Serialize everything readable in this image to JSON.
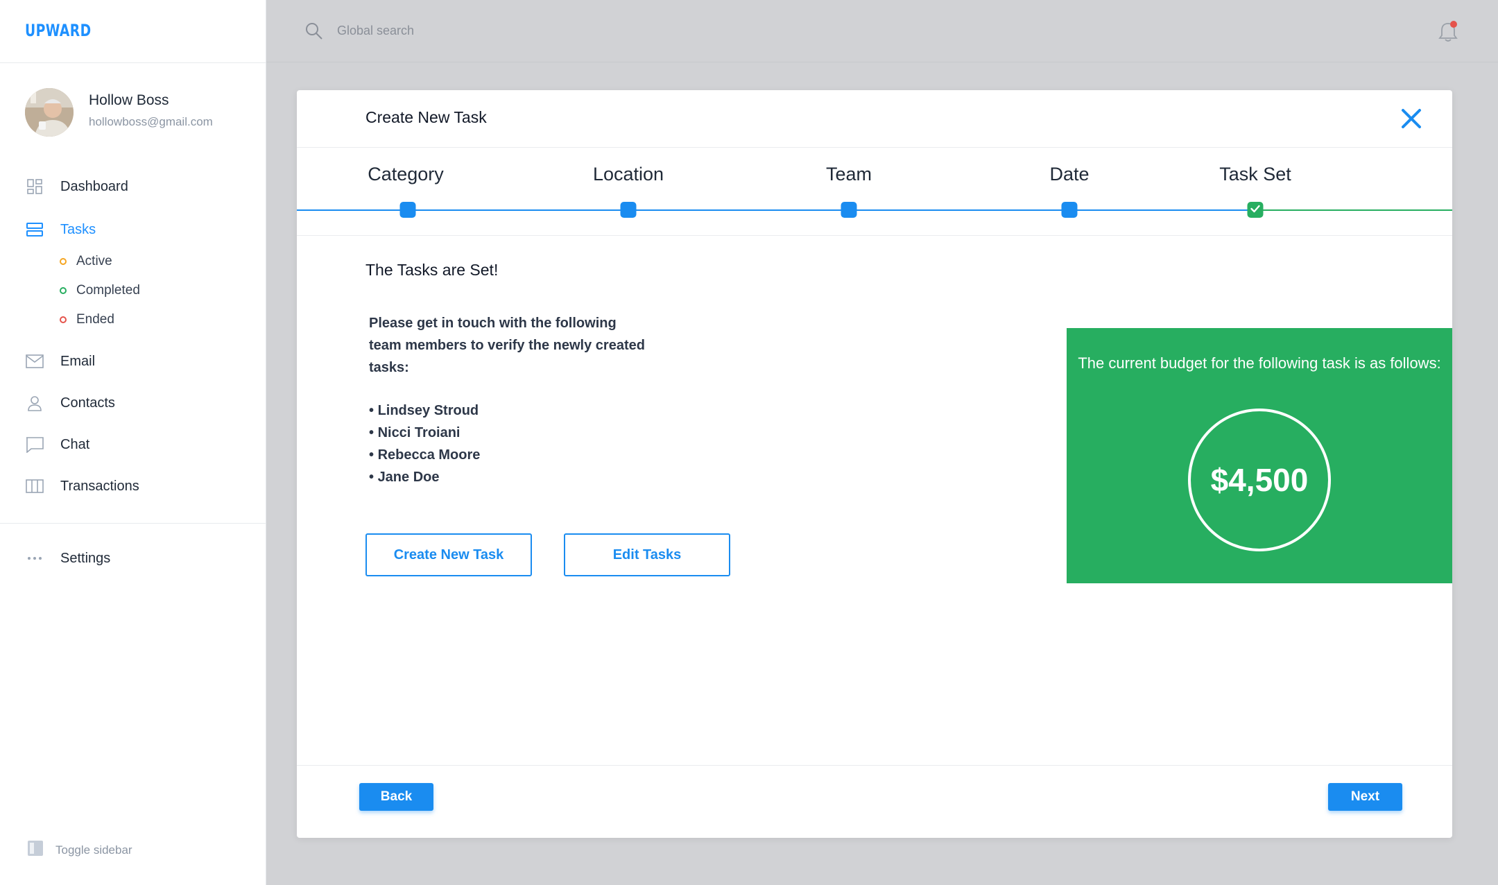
{
  "app": {
    "logo": "UPWARD"
  },
  "user": {
    "name": "Hollow Boss",
    "email": "hollowboss@gmail.com"
  },
  "sidebar": {
    "items": [
      {
        "label": "Dashboard",
        "icon": "dashboard-icon"
      },
      {
        "label": "Tasks",
        "icon": "tasks-icon",
        "active": true
      },
      {
        "label": "Email",
        "icon": "mail-icon"
      },
      {
        "label": "Contacts",
        "icon": "user-icon"
      },
      {
        "label": "Chat",
        "icon": "chat-icon"
      },
      {
        "label": "Transactions",
        "icon": "columns-icon"
      }
    ],
    "task_filters": [
      {
        "label": "Active",
        "color": "#f5a623"
      },
      {
        "label": "Completed",
        "color": "#27ae60"
      },
      {
        "label": "Ended",
        "color": "#e5534b"
      }
    ],
    "settings_label": "Settings",
    "toggle_label": "Toggle sidebar"
  },
  "search": {
    "placeholder": "Global search"
  },
  "modal": {
    "title": "Create New Task",
    "steps": [
      "Category",
      "Location",
      "Team",
      "Date",
      "Task Set"
    ],
    "set_title": "The Tasks are Set!",
    "message": "Please get in touch with the following team members to verify the newly created tasks:",
    "members": [
      "Lindsey Stroud",
      "Nicci Troiani",
      "Rebecca Moore",
      "Jane Doe"
    ],
    "create_button": "Create New Task",
    "edit_button": "Edit Tasks",
    "budget_text": "The current budget for the following task is as follows:",
    "budget_amount": "$4,500",
    "back_button": "Back",
    "next_button": "Next"
  },
  "colors": {
    "accent": "#1a8cf0",
    "success": "#27ae60",
    "background": "#d1d2d5"
  }
}
